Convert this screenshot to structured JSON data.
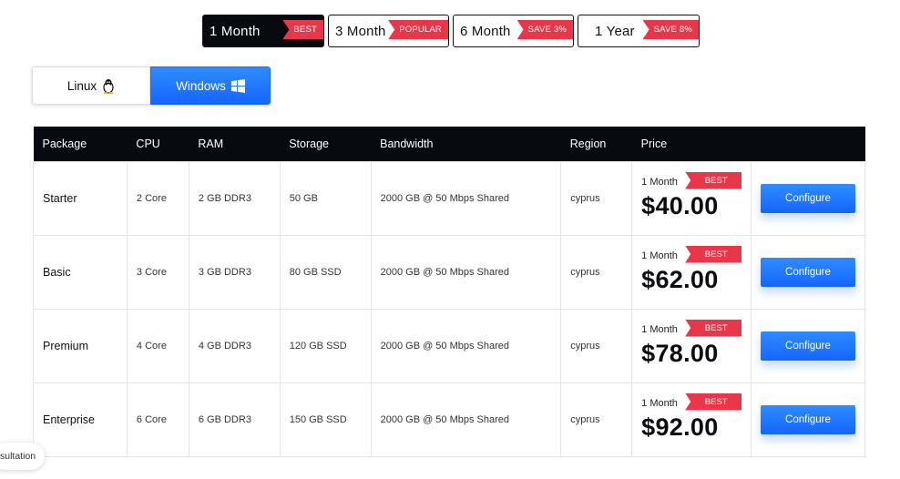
{
  "period_tabs": [
    {
      "label": "1 Month",
      "badge": "BEST",
      "active": true
    },
    {
      "label": "3 Month",
      "badge": "POPULAR",
      "active": false
    },
    {
      "label": "6 Month",
      "badge": "SAVE 3%",
      "active": false
    },
    {
      "label": "1 Year",
      "badge": "SAVE 8%",
      "active": false
    }
  ],
  "os_toggle": {
    "linux_label": "Linux",
    "linux_icon": "linux-tux-icon",
    "windows_label": "Windows",
    "windows_icon": "windows-logo-icon",
    "selected": "Windows"
  },
  "table": {
    "headers": [
      "Package",
      "CPU",
      "RAM",
      "Storage",
      "Bandwidth",
      "Region",
      "Price",
      ""
    ],
    "rows": [
      {
        "package": "Starter",
        "cpu": "2 Core",
        "ram": "2 GB DDR3",
        "storage": "50 GB",
        "bandwidth": "2000 GB @ 50 Mbps Shared",
        "region": "cyprus",
        "period": "1 Month",
        "badge": "BEST",
        "price": "$40.00",
        "action": "Configure"
      },
      {
        "package": "Basic",
        "cpu": "3 Core",
        "ram": "3 GB DDR3",
        "storage": "80 GB SSD",
        "bandwidth": "2000 GB @ 50 Mbps Shared",
        "region": "cyprus",
        "period": "1 Month",
        "badge": "BEST",
        "price": "$62.00",
        "action": "Configure"
      },
      {
        "package": "Premium",
        "cpu": "4 Core",
        "ram": "4 GB DDR3",
        "storage": "120 GB SSD",
        "bandwidth": "2000 GB @ 50 Mbps Shared",
        "region": "cyprus",
        "period": "1 Month",
        "badge": "BEST",
        "price": "$78.00",
        "action": "Configure"
      },
      {
        "package": "Enterprise",
        "cpu": "6 Core",
        "ram": "6 GB DDR3",
        "storage": "150 GB SSD",
        "bandwidth": "2000 GB @ 50 Mbps Shared",
        "region": "cyprus",
        "period": "1 Month",
        "badge": "BEST",
        "price": "$92.00",
        "action": "Configure"
      }
    ]
  },
  "consult_chip": "sultation",
  "colors": {
    "accent_blue": "#1565ff",
    "badge_red": "#e8374a",
    "header_dark": "#070b10"
  }
}
